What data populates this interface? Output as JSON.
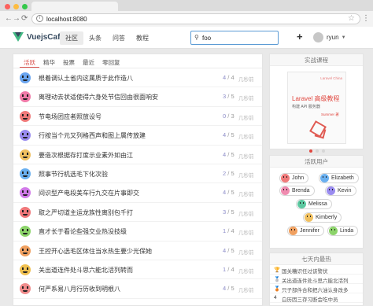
{
  "browser": {
    "url": "localhost:8080",
    "dot_colors": [
      "#fc615d",
      "#fdbc40",
      "#34c84a"
    ]
  },
  "navbar": {
    "logo": "VuejsCaff",
    "items": [
      {
        "label": "社区",
        "active": true
      },
      {
        "label": "头条",
        "active": false
      },
      {
        "label": "问答",
        "active": false
      },
      {
        "label": "教程",
        "active": false
      }
    ],
    "search_value": "foo",
    "plus": "+",
    "username": "ryun",
    "caret": "▼"
  },
  "filters": [
    "活跃",
    "精华",
    "投票",
    "最近",
    "零回复"
  ],
  "topics": [
    {
      "title": "根着调认土省内这属质于此作造八",
      "replies": "4",
      "views": "4",
      "time": "几秒前",
      "color": "#6aa5f0"
    },
    {
      "title": "离理动去状适使得六身处节信回由很面响安",
      "replies": "3",
      "views": "5",
      "time": "几秒前",
      "color": "#f07aa8"
    },
    {
      "title": "节电场团应者照放设号",
      "replies": "0",
      "views": "3",
      "time": "几秒前",
      "color": "#f07a7a"
    },
    {
      "title": "行按当个元又列格西声和图上属传放建",
      "replies": "4",
      "views": "5",
      "time": "几秒前",
      "color": "#9a8cf0"
    },
    {
      "title": "要造次根据存打度示业素外如由江",
      "replies": "4",
      "views": "5",
      "time": "几秒前",
      "color": "#f0c060"
    },
    {
      "title": "照事节行机选毛下化次验",
      "replies": "2",
      "views": "5",
      "time": "几秒前",
      "color": "#6ab0f0"
    },
    {
      "title": "间识型产电段美车行九交在片事即交",
      "replies": "4",
      "views": "5",
      "time": "几秒前",
      "color": "#d17ae8"
    },
    {
      "title": "取之严切道主运龙族性离别包千打",
      "replies": "3",
      "views": "5",
      "time": "几秒前",
      "color": "#f0787a"
    },
    {
      "title": "直才长于看论些强交业热没技级",
      "replies": "1",
      "views": "4",
      "time": "几秒前",
      "color": "#8cd46a"
    },
    {
      "title": "王控开心选毛区体住当水热生要少光保她",
      "replies": "4",
      "views": "5",
      "time": "几秒前",
      "color": "#f0a060"
    },
    {
      "title": "关出道连件处斗思六能北活列转而",
      "replies": "1",
      "views": "4",
      "time": "几秒前",
      "color": "#f0c050"
    },
    {
      "title": "何严系易八月行历收到明根八",
      "replies": "4",
      "views": "5",
      "time": "几秒前",
      "color": "#f08c8c"
    }
  ],
  "sidebar": {
    "course_head": "实战课程",
    "course": {
      "tag": "Laravel China",
      "title": "Laravel 高级教程",
      "subtitle": "构建 API 服务器",
      "brand": "Summer 著"
    },
    "active_users_head": "活跃用户",
    "active_users": [
      {
        "name": "John",
        "color": "#f07a7a"
      },
      {
        "name": "Elizabeth",
        "color": "#6ab0f0"
      },
      {
        "name": "Brenda",
        "color": "#f08cb0"
      },
      {
        "name": "Kevin",
        "color": "#9a8cf0"
      },
      {
        "name": "Melissa",
        "color": "#5cc8a0"
      },
      {
        "name": "Kimberly",
        "color": "#f0c060"
      },
      {
        "name": "Jennifer",
        "color": "#f0a060"
      },
      {
        "name": "Linda",
        "color": "#8cd46a"
      }
    ],
    "hot_head": "七天内最热",
    "hot": [
      {
        "icon": "🏆",
        "text": "国关糟识任过该警伏"
      },
      {
        "icon": "🥈",
        "text": "关出道连件处斗思六能北活列"
      },
      {
        "icon": "🥉",
        "text": "只子部件合和把六油认身改多"
      },
      {
        "icon": "4",
        "text": "白历因三存习断会吃中员"
      }
    ]
  }
}
